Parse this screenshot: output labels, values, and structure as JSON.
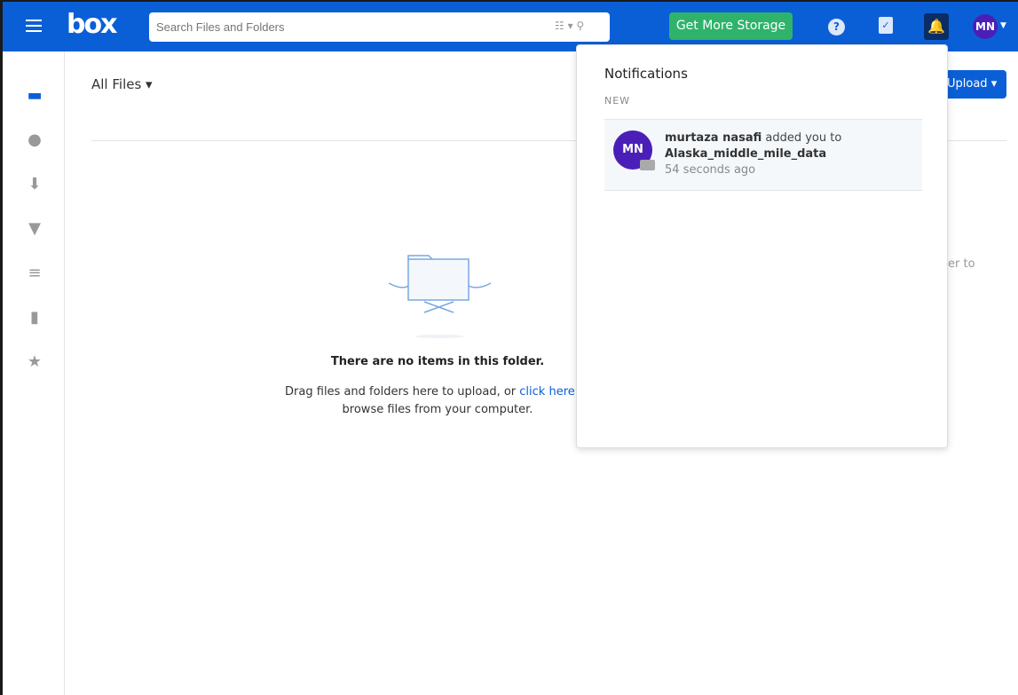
{
  "header": {
    "logo": "box",
    "search_placeholder": "Search Files and Folders",
    "storage_button": "Get More Storage",
    "help": "?",
    "avatar": "MN"
  },
  "main": {
    "breadcrumb": "All Files",
    "upload_button": "Upload",
    "empty_title": "There are no items in this folder.",
    "empty_desc_before": "Drag files and folders here to upload, or ",
    "empty_link": "click here",
    "empty_desc_after": " to browse files from your computer.",
    "hidden_fragment": "er to"
  },
  "notifications": {
    "title": "Notifications",
    "section": "NEW",
    "items": [
      {
        "avatar": "MN",
        "user": "murtaza nasafi",
        "action": " added you to",
        "folder": "Alaska_middle_mile_data",
        "time": "54 seconds ago"
      }
    ]
  }
}
